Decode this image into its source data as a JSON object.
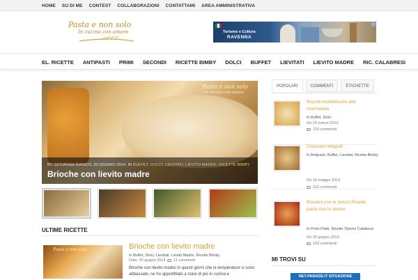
{
  "topnav": [
    "HOME",
    "SU DI ME",
    "CONTEST",
    "COLLABORAZIONI",
    "CONTATTAMI",
    "AREA AMMINISTRATIVA"
  ],
  "logo": {
    "line1": "Pasta e non solo",
    "line2": "In cucina con amore"
  },
  "banner": {
    "line1": "Turismo e Cultura",
    "line2": "RAVENNA"
  },
  "mainnav": [
    "EL. RICETTE",
    "ANTIPASTI",
    "PRIMI",
    "SECONDI",
    "RICETTE BIMBY",
    "DOLCI",
    "BUFFET",
    "LIEVITATI",
    "LIEVITO MADRE",
    "RIC. CALABRESI"
  ],
  "hero": {
    "meta_prefix": "BY GIOVANNA BIANCO, 20 GIUGNO 2014, IN",
    "meta_cats": "BUFFET, DOLCI, LIEVITATI, LIEVITO MADRE, RICETTE BIMBY",
    "title": "Brioche con lievito madre",
    "watermark1": "Pasta e non solo",
    "watermark2": "In cucina con amore"
  },
  "thumbnails": [
    {
      "colors": [
        "#8a6a3a",
        "#e6cfa0"
      ]
    },
    {
      "colors": [
        "#4a3a2a",
        "#c98a40"
      ]
    },
    {
      "colors": [
        "#3f5a2a",
        "#e0c070"
      ]
    },
    {
      "colors": [
        "#b33a1a",
        "#9bc050"
      ]
    }
  ],
  "latest": {
    "section_title": "ULTIME RICETTE",
    "post": {
      "title": "Brioche con lievito madre",
      "categories": "In Buffet, Dolci, Lievitati, Lievito Madre, Ricette Bimby",
      "date": "Data: 20 giugno 2014",
      "comments": "11 commenti",
      "excerpt": "Brioche con lievito madre In questi giorni che la temperature si sono abbassate, ne ho approfittato a stare di più in cucina e",
      "watermark": "Pasta e non solo"
    }
  },
  "sidebar": {
    "tabs": [
      "POPOLARI",
      "COMMENTI",
      "ETICHETTE"
    ],
    "items": [
      {
        "title": "Biscotti morbidissimi alla marmellata",
        "categories": "In Buffet, Dolci",
        "date": "On 23 marzo 2013",
        "comments": "116 commenti",
        "colors": [
          "#d9a24a",
          "#f4e2b4"
        ]
      },
      {
        "title": "Croissant integrali",
        "categories": "In Antipasti, Buffet, Lievitati, Ricetta Bimby",
        "date": "On 10 maggio 2013",
        "comments": "112 commenti",
        "colors": [
          "#a06a30",
          "#e9c98a"
        ]
      },
      {
        "title": "Bucatini con lo stocco Ricetta pasta con lo stocco",
        "categories": "In Primi Piatti, Ricette Tipiche Calabresi",
        "date": "On 20 giugno 2013",
        "comments": "109 commenti",
        "colors": [
          "#a82a14",
          "#e8a050"
        ]
      }
    ],
    "trovi_title": "MI TROVI SU",
    "badge": "NET-PARADE.IT SITUAZIONE"
  },
  "colors": {
    "accent": "#d8a033",
    "nav_bg": "#ffffff",
    "topbar_bg": "#f3f3f3"
  },
  "icons": [
    "comment-bubble-icon"
  ]
}
